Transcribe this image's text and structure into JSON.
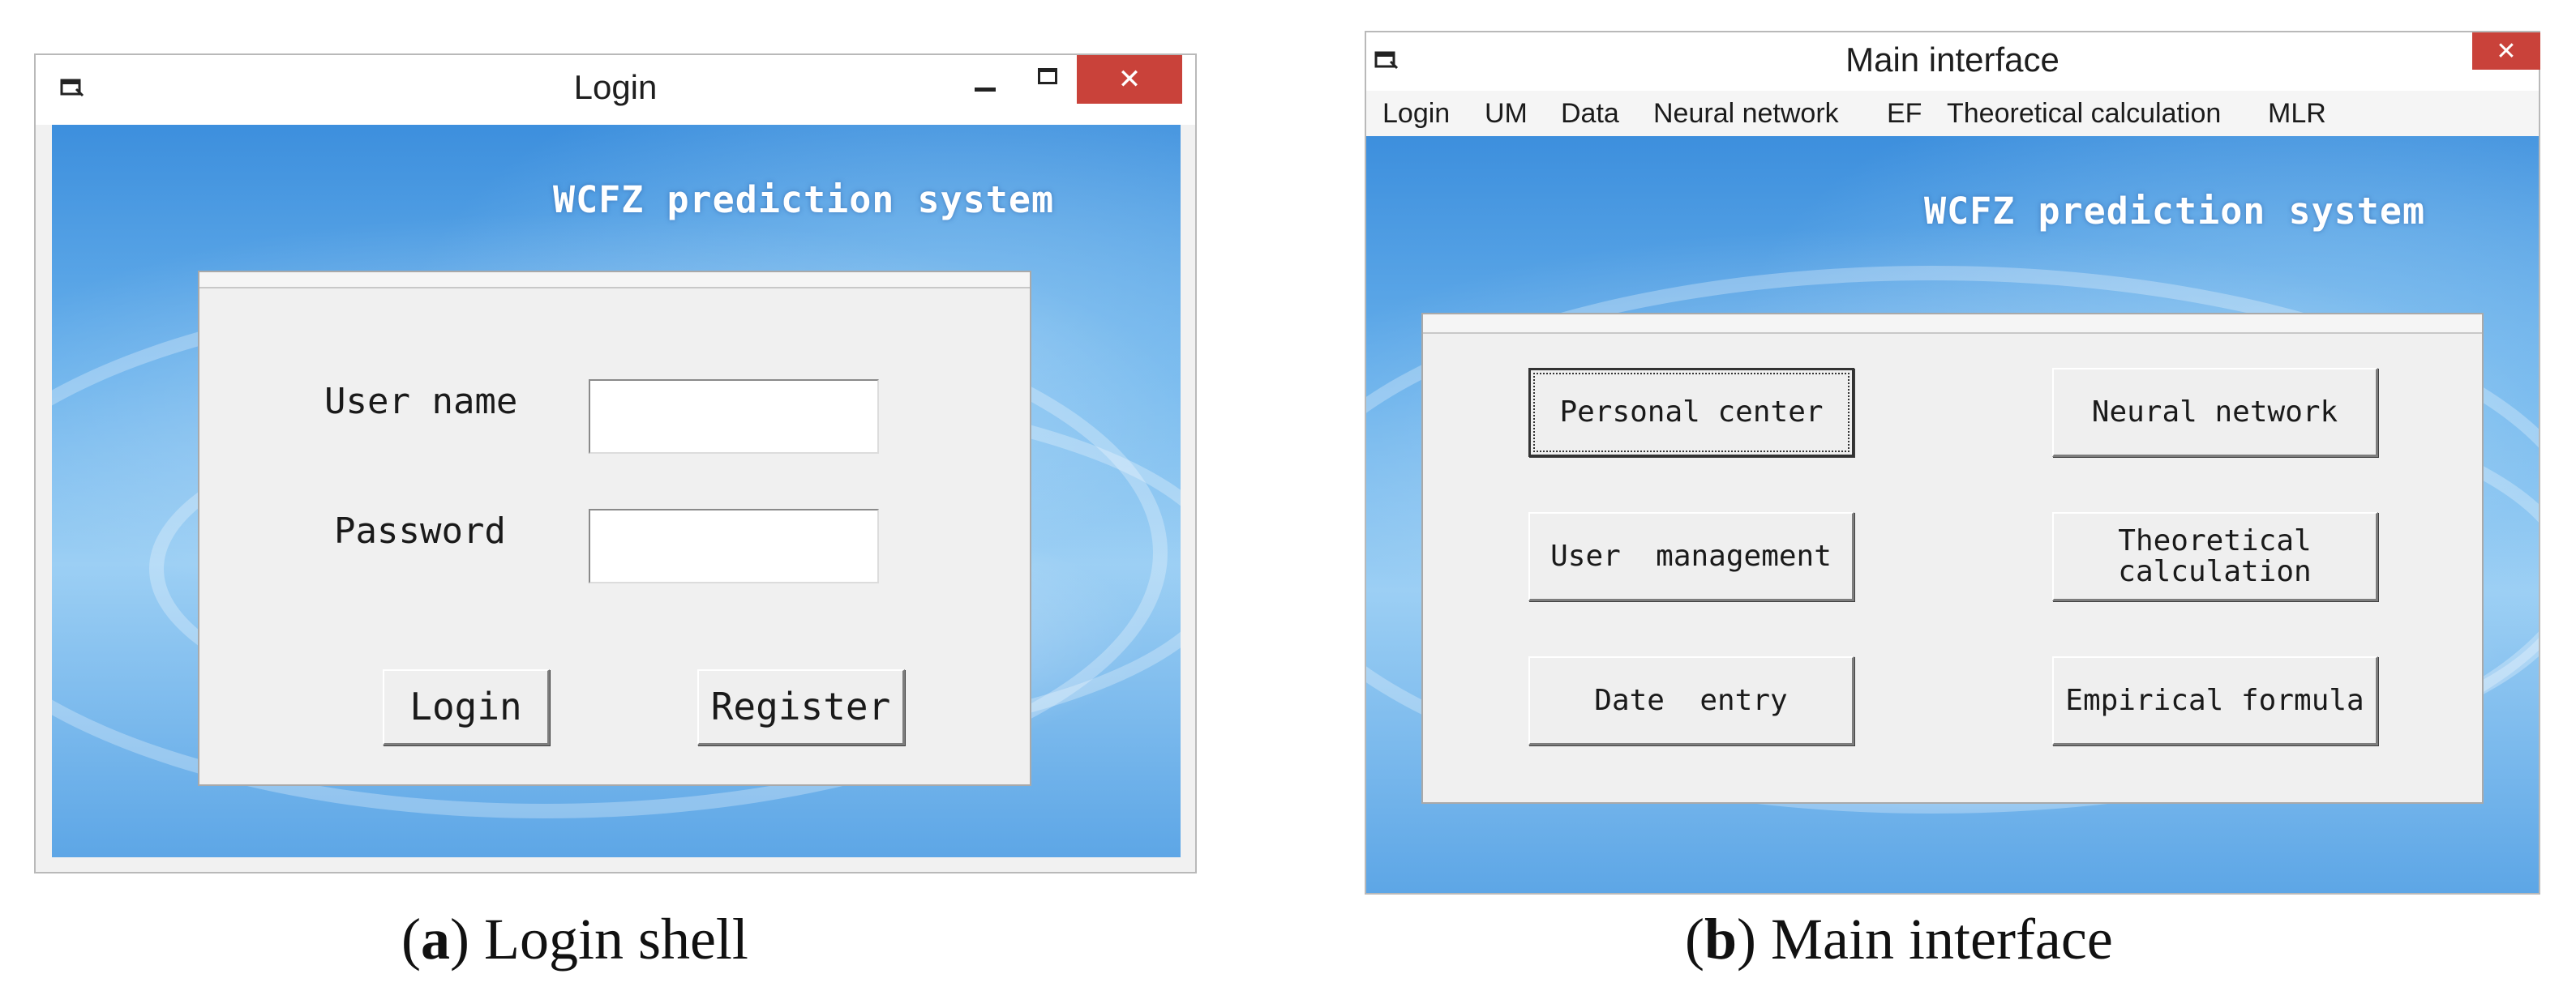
{
  "login_window": {
    "title": "Login",
    "brand": "WCFZ prediction system",
    "username_label": "User name",
    "username_value": "",
    "password_label": "Password",
    "password_value": "",
    "login_button": "Login",
    "register_button": "Register",
    "close_glyph": "✕",
    "caption_letter": "a",
    "caption_text": " Login shell"
  },
  "main_window": {
    "title": "Main interface",
    "brand": "WCFZ prediction system",
    "menu": [
      "Login",
      "UM",
      "Data",
      "Neural network",
      "EF",
      "Theoretical calculation",
      "MLR"
    ],
    "buttons": {
      "personal_center": "Personal center",
      "neural_network": "Neural network",
      "user_management": "User  management",
      "theoretical_calculation": "Theoretical\ncalculation",
      "date_entry": "Date  entry",
      "empirical_formula": "Empirical formula"
    },
    "close_glyph": "✕",
    "caption_letter": "b",
    "caption_text": " Main interface"
  },
  "colors": {
    "close_red": "#c9423a",
    "sky_blue": "#5da6e6",
    "panel_gray": "#f0f0f0"
  },
  "icons": [
    "window-app-icon",
    "minimize-icon",
    "maximize-icon",
    "close-icon"
  ]
}
